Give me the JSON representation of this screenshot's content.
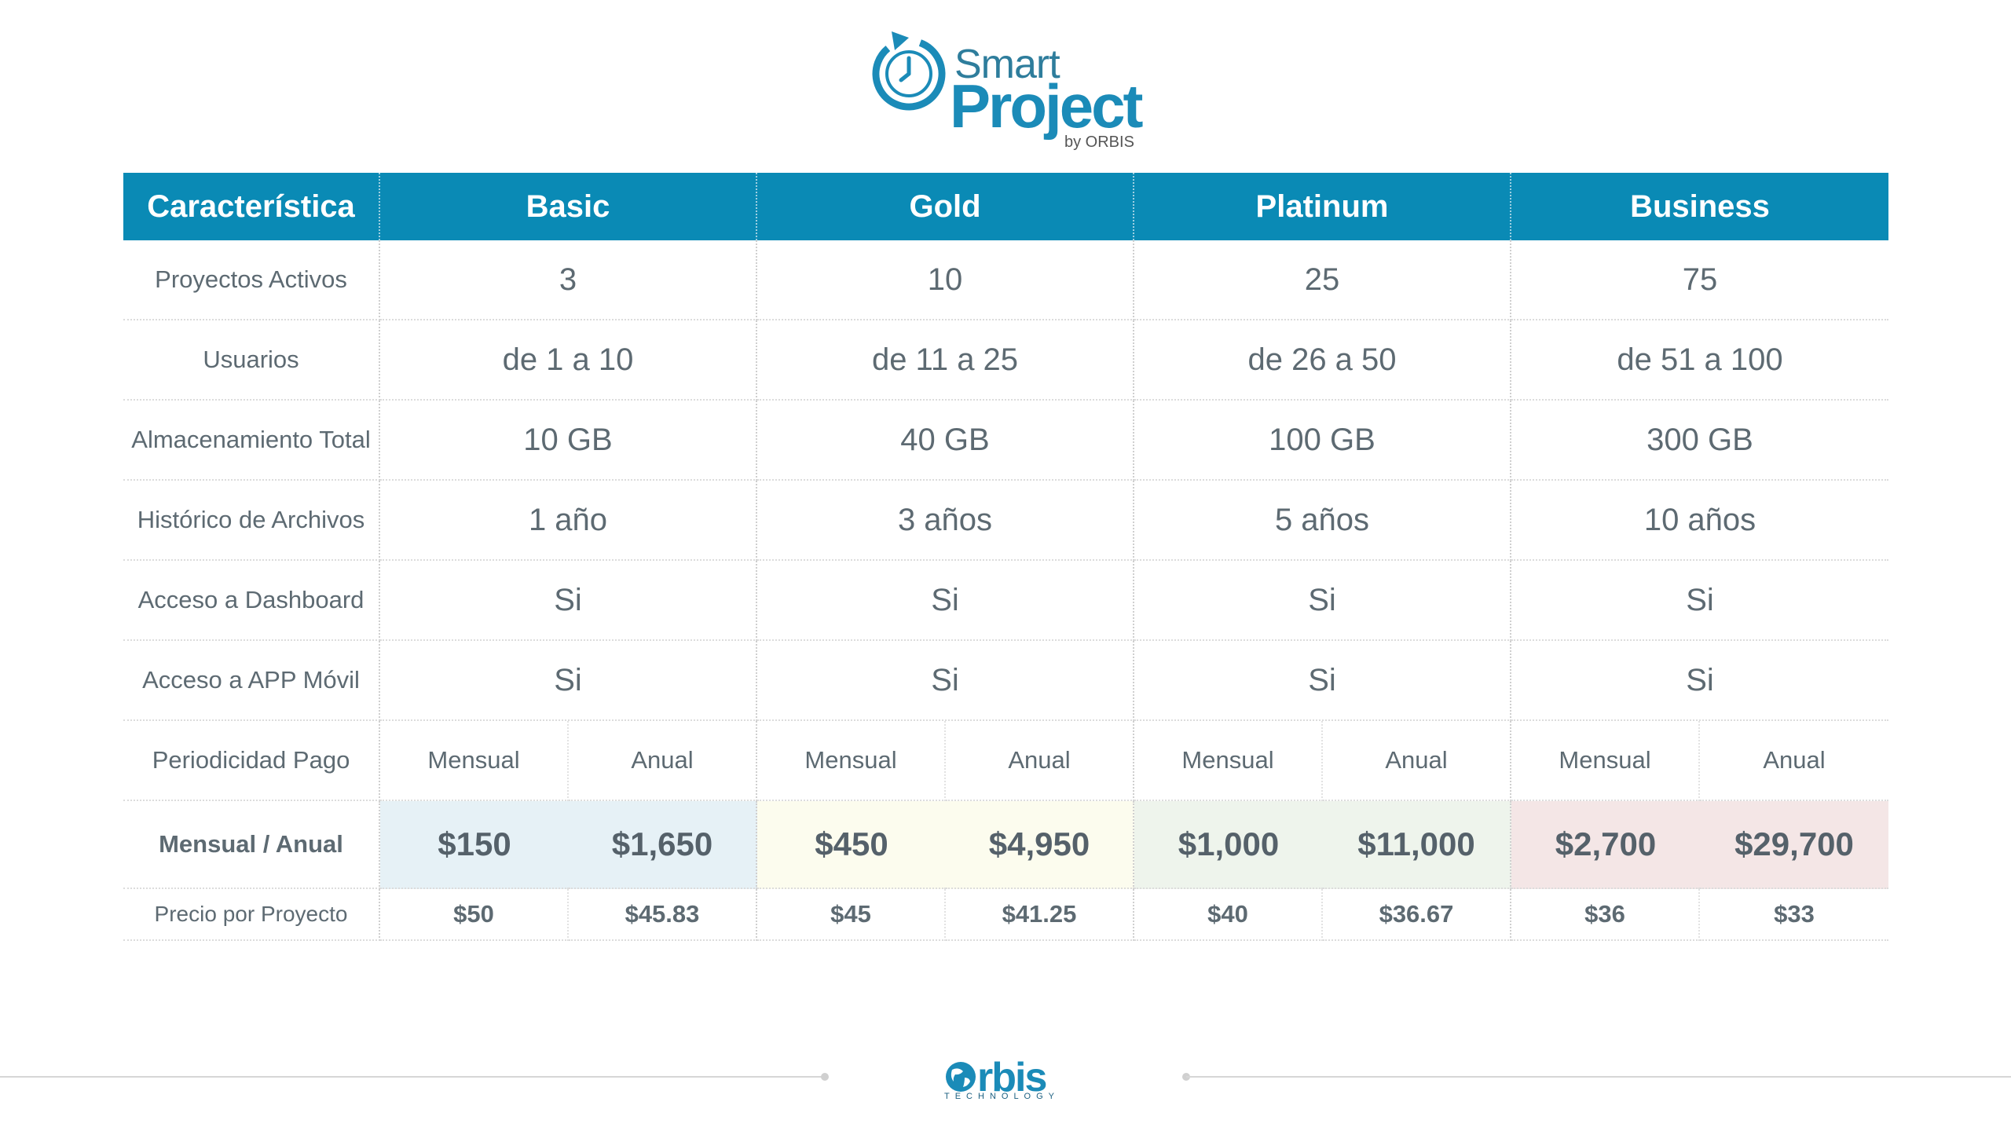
{
  "logo": {
    "line1": "Smart",
    "line2": "Project",
    "byline": "by ORBIS"
  },
  "table": {
    "header": {
      "feature": "Característica",
      "plans": [
        "Basic",
        "Gold",
        "Platinum",
        "Business"
      ]
    },
    "rows": [
      {
        "feature": "Proyectos  Activos",
        "values": [
          "3",
          "10",
          "25",
          "75"
        ]
      },
      {
        "feature": "Usuarios",
        "values": [
          "de 1 a 10",
          "de 11 a 25",
          "de 26 a 50",
          "de 51 a 100"
        ]
      },
      {
        "feature": "Almacenamiento Total",
        "values": [
          "10 GB",
          "40 GB",
          "100 GB",
          "300 GB"
        ]
      },
      {
        "feature": "Histórico de Archivos",
        "values": [
          "1 año",
          "3 años",
          "5 años",
          "10 años"
        ]
      },
      {
        "feature": "Acceso a Dashboard",
        "values": [
          "Si",
          "Si",
          "Si",
          "Si"
        ]
      },
      {
        "feature": "Acceso a APP Móvil",
        "values": [
          "Si",
          "Si",
          "Si",
          "Si"
        ]
      }
    ],
    "periodicity": {
      "label": "Periodicidad  Pago",
      "monthly": "Mensual",
      "annual": "Anual"
    },
    "prices": {
      "label": "Mensual / Anual",
      "values": [
        "$150",
        "$1,650",
        "$450",
        "$4,950",
        "$1,000",
        "$11,000",
        "$2,700",
        "$29,700"
      ]
    },
    "per_project": {
      "label": "Precio por Proyecto",
      "values": [
        "$50",
        "$45.83",
        "$45",
        "$41.25",
        "$40",
        "$36.67",
        "$36",
        "$33"
      ]
    }
  },
  "footer": {
    "brand": "rbis",
    "tagline": "TECHNOLOGY"
  },
  "colors": {
    "header_bg": "#0a8ab5",
    "basic_bg": "#e6f1f6",
    "gold_bg": "#fcfcee",
    "platinum_bg": "#eef4ec",
    "business_bg": "#f4e6e6"
  }
}
